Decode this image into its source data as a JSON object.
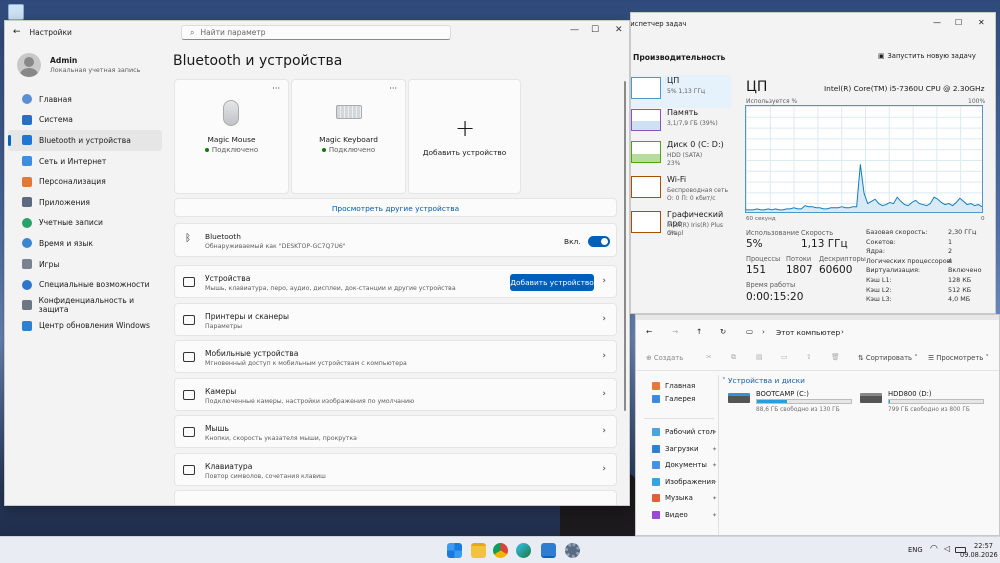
{
  "settings": {
    "window_title": "Настройки",
    "search_placeholder": "Найти параметр",
    "user": {
      "name": "Admin",
      "role": "Локальная учетная запись"
    },
    "nav": [
      {
        "label": "Главная",
        "color": "#5a8fd6"
      },
      {
        "label": "Система",
        "color": "#2b6fc4"
      },
      {
        "label": "Bluetooth и устройства",
        "color": "#1f77d0"
      },
      {
        "label": "Сеть и Интернет",
        "color": "#3c8fe0"
      },
      {
        "label": "Персонализация",
        "color": "#e0793a"
      },
      {
        "label": "Приложения",
        "color": "#5d6b80"
      },
      {
        "label": "Учетные записи",
        "color": "#2aa06a"
      },
      {
        "label": "Время и язык",
        "color": "#3a86d0"
      },
      {
        "label": "Игры",
        "color": "#7a8290"
      },
      {
        "label": "Специальные возможности",
        "color": "#2d76c8"
      },
      {
        "label": "Конфиденциальность и защита",
        "color": "#6d7784"
      },
      {
        "label": "Центр обновления Windows",
        "color": "#2f7fd1"
      }
    ],
    "page_title": "Bluetooth и устройства",
    "devices": [
      {
        "name": "Magic Mouse",
        "status": "Подключено"
      },
      {
        "name": "Magic Keyboard",
        "status": "Подключено"
      }
    ],
    "add_device_tile": "Добавить устройство",
    "more_dots": "···",
    "view_more": "Просмотреть другие устройства",
    "bluetooth": {
      "title": "Bluetooth",
      "sub": "Обнаруживаемый как \"DESKTOP-GC7Q7U6\"",
      "state": "Вкл."
    },
    "rows": [
      {
        "title": "Устройства",
        "sub": "Мышь, клавиатура, перо, аудио, дисплеи, док-станции и другие устройства",
        "button": "Добавить устройство"
      },
      {
        "title": "Принтеры и сканеры",
        "sub": "Параметры"
      },
      {
        "title": "Мобильные устройства",
        "sub": "Мгновенный доступ к мобильным устройствам с компьютера"
      },
      {
        "title": "Камеры",
        "sub": "Подключенные камеры, настройки изображения по умолчанию"
      },
      {
        "title": "Мышь",
        "sub": "Кнопки, скорость указателя мыши, прокрутка"
      },
      {
        "title": "Клавиатура",
        "sub": "Повтор символов, сочетания клавиш"
      }
    ],
    "accent": "#005fb8"
  },
  "taskmgr": {
    "title": "Диспетчер задач",
    "section": "Производительность",
    "run_task": "Запустить новую задачу",
    "side": [
      {
        "label": "ЦП",
        "sub": "5% 1,13 ГГц"
      },
      {
        "label": "Память",
        "sub": "3,1/7,9 ГБ (39%)"
      },
      {
        "label": "Диск 0 (C: D:)",
        "sub": "HDD (SATA)",
        "sub2": "23%"
      },
      {
        "label": "Wi-Fi",
        "sub": "Беспроводная сеть",
        "sub2": "О: 0 П: 0 кбит/с"
      },
      {
        "label": "Графический про",
        "sub": "Intel(R) Iris(R) Plus Grapl",
        "sub2": "0%"
      }
    ],
    "cpu_title": "ЦП",
    "cpu_model": "Intel(R) Core(TM) i5-7360U CPU @ 2.30GHz",
    "usage_label": "Используется %",
    "usage_max": "100%",
    "graph_left": "60 секунд",
    "graph_right": "0",
    "cpu_history": [
      2,
      2,
      2,
      3,
      2,
      2,
      3,
      2,
      3,
      2,
      2,
      3,
      3,
      4,
      3,
      3,
      6,
      5,
      5,
      4,
      4,
      3,
      3,
      4,
      4,
      4,
      5,
      4,
      4,
      5,
      5,
      45,
      18,
      8,
      10,
      12,
      8,
      6,
      7,
      9,
      8,
      14,
      10,
      7,
      6,
      9,
      11,
      8,
      7,
      6,
      8,
      14,
      12,
      9,
      7,
      8,
      6,
      9,
      13,
      10,
      7,
      8,
      6,
      7,
      5
    ],
    "stats": {
      "usage_l": "Использование",
      "usage_v": "5%",
      "speed_l": "Скорость",
      "speed_v": "1,13 ГГц",
      "proc_l": "Процессы",
      "proc_v": "151",
      "threads_l": "Потоки",
      "threads_v": "1807",
      "handles_l": "Дескрипторы",
      "handles_v": "60600",
      "uptime_l": "Время работы",
      "uptime_v": "0:00:15:20"
    },
    "specs": [
      {
        "k": "Базовая скорость:",
        "v": "2,30 ГГц"
      },
      {
        "k": "Сокетов:",
        "v": "1"
      },
      {
        "k": "Ядра:",
        "v": "2"
      },
      {
        "k": "Логических процессоров:",
        "v": "4"
      },
      {
        "k": "Виртуализация:",
        "v": "Включено"
      },
      {
        "k": "Кэш L1:",
        "v": "128 КБ"
      },
      {
        "k": "Кэш L2:",
        "v": "512 КБ"
      },
      {
        "k": "Кэш L3:",
        "v": "4,0 МБ"
      }
    ],
    "accent": "#117dbb"
  },
  "explorer": {
    "title": "Этот компьютер",
    "toolbar": {
      "create": "Создать",
      "sort": "Сортировать",
      "view": "Просмотреть"
    },
    "nav": [
      "Главная",
      "Галерея",
      "Рабочий стол",
      "Загрузки",
      "Документы",
      "Изображения",
      "Музыка",
      "Видео"
    ],
    "section": "Устройства и диски",
    "drives": [
      {
        "name": "BOOTCAMP (C:)",
        "free": "88,6 ГБ свободно из 130 ГБ",
        "used_fraction": 0.32
      },
      {
        "name": "HDD800 (D:)",
        "free": "799 ГБ свободно из 800 ГБ",
        "used_fraction": 0.01
      }
    ]
  },
  "taskbar": {
    "lang": "ENG",
    "time": "22:57",
    "date": "09.08.2026"
  }
}
